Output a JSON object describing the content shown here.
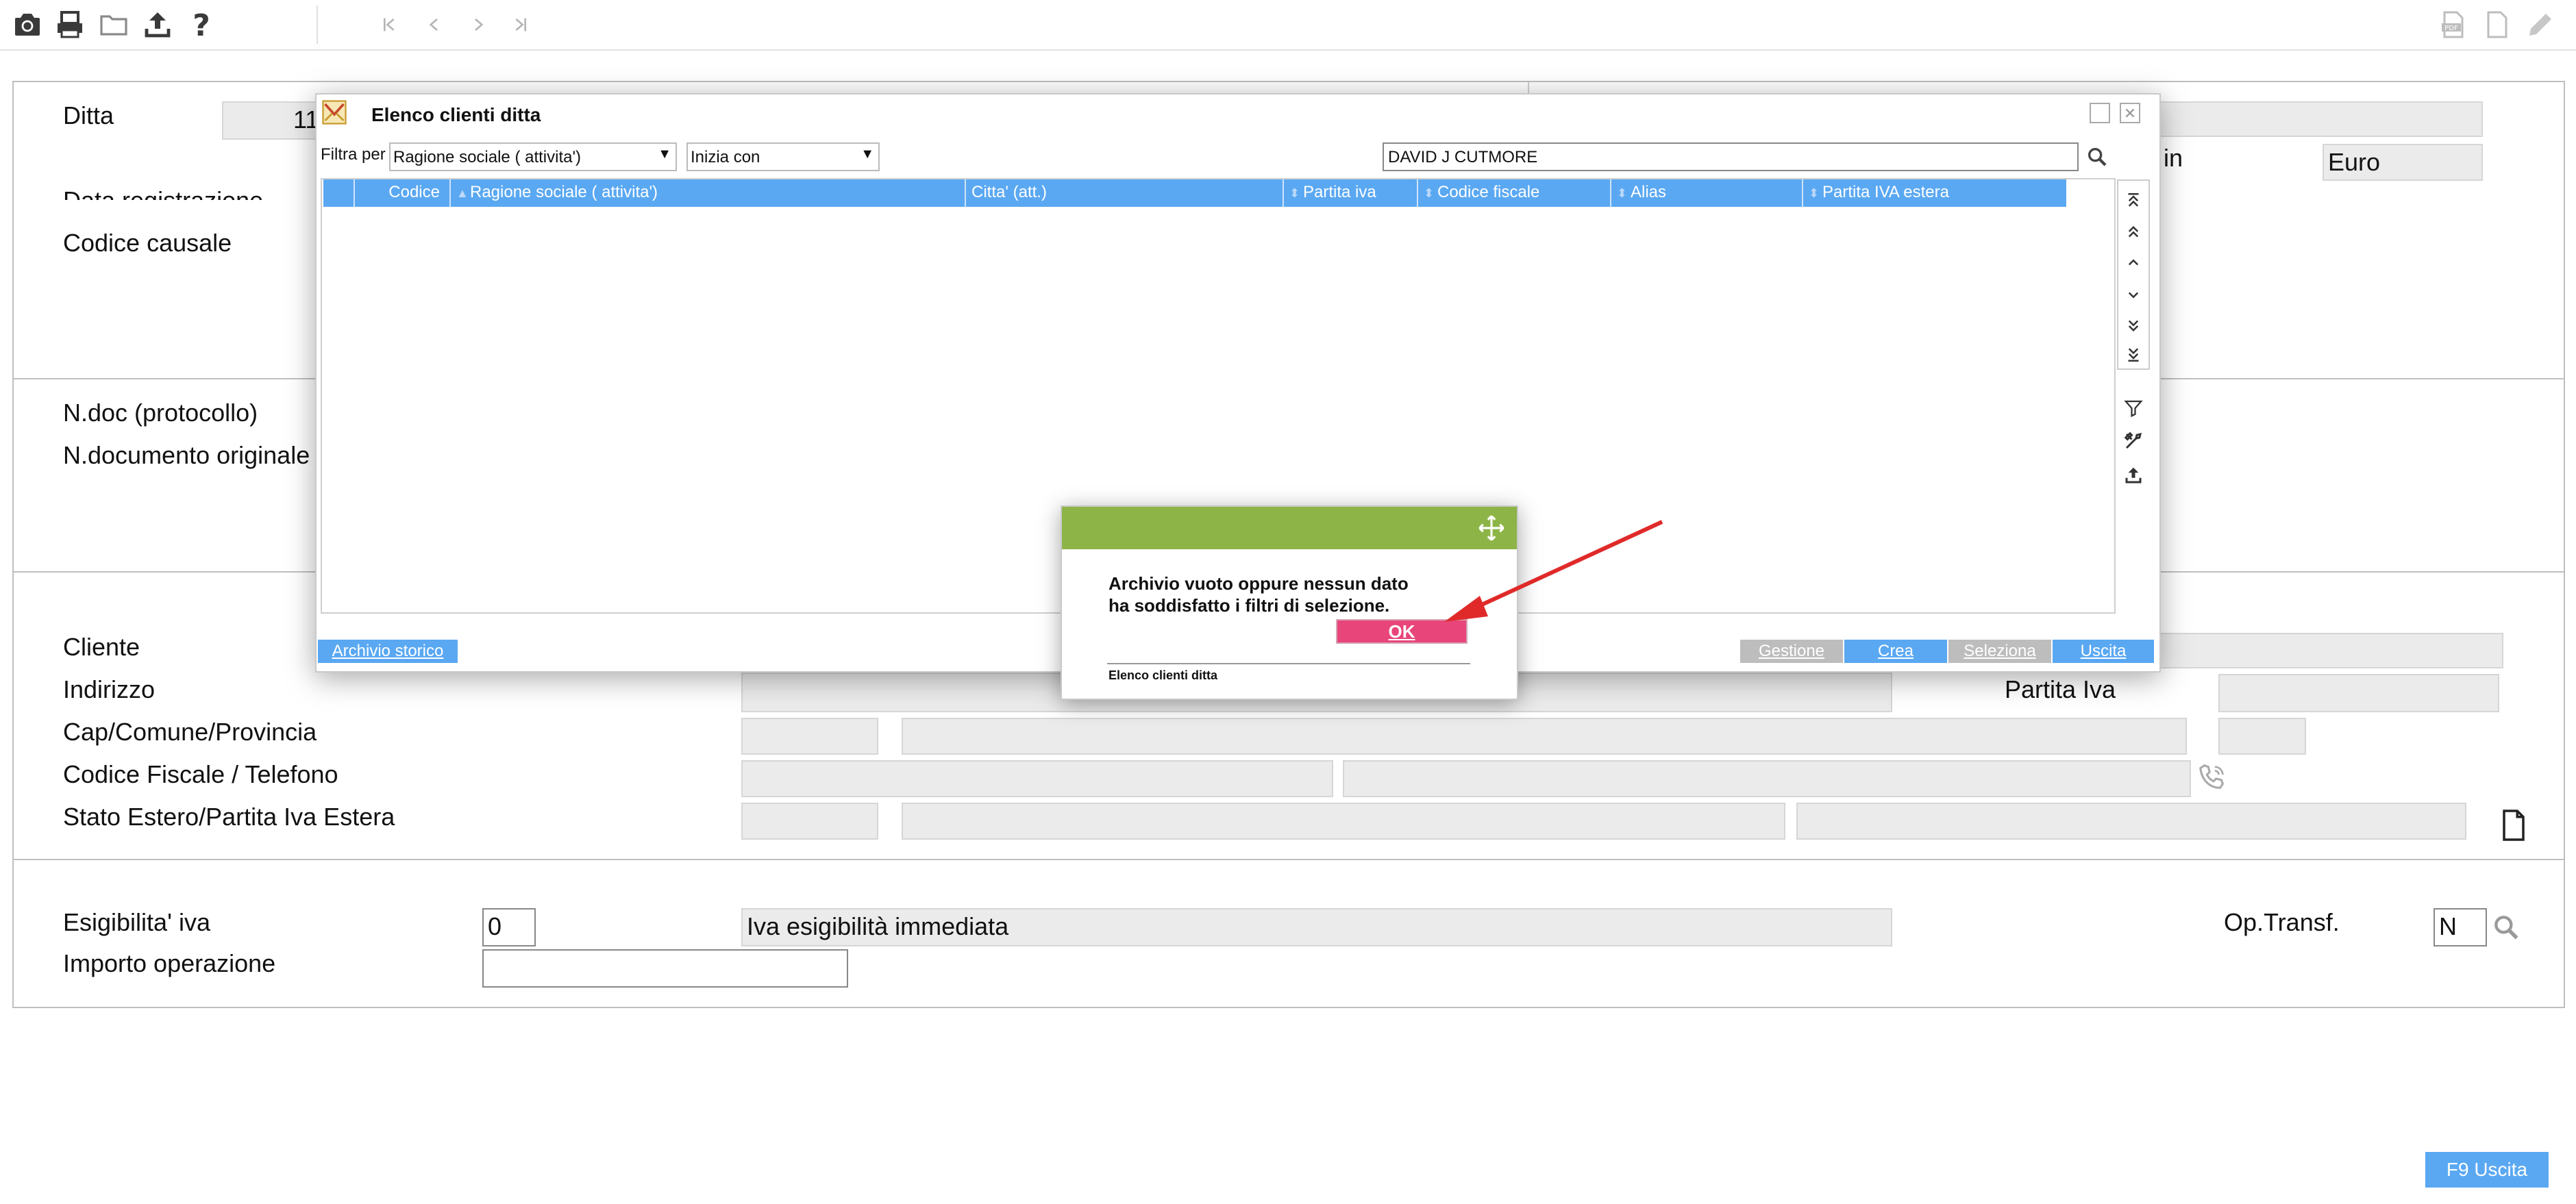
{
  "toolbar": {
    "icons": [
      "camera-icon",
      "printer-icon",
      "folder-icon",
      "upload-icon",
      "help-icon"
    ],
    "nav": [
      "first-page-icon",
      "prev-page-icon",
      "next-page-icon",
      "last-page-icon"
    ],
    "right_icons": [
      "pdf-icon",
      "document-icon",
      "edit-icon"
    ]
  },
  "form": {
    "ditta_label": "Ditta",
    "ditta_value": "11",
    "valuta_label_partial": "in",
    "valuta_value": "Euro",
    "data_registrazione_label": "Data registrazione",
    "codice_causale_label": "Codice causale",
    "ndoc_label": "N.doc (protocollo)",
    "ndoc_originale_label": "N.documento originale",
    "cliente_label": "Cliente",
    "indirizzo_label": "Indirizzo",
    "partita_iva_label": "Partita Iva",
    "cap_label": "Cap/Comune/Provincia",
    "cf_label": "Codice Fiscale / Telefono",
    "stato_estero_label": "Stato Estero/Partita Iva Estera",
    "esigibilita_label": "Esigibilita' iva",
    "esigibilita_code": "0",
    "esigibilita_desc": "Iva esigibilità immediata",
    "op_transf_label": "Op.Transf.",
    "op_transf_value": "N",
    "importo_label": "Importo operazione",
    "f9_button": "F9 Uscita"
  },
  "dialog": {
    "title": "Elenco clienti ditta",
    "filter_label": "Filtra per",
    "filter_field": "Ragione sociale ( attivita')",
    "filter_mode": "Inizia con",
    "search_value": "DAVID J CUTMORE",
    "columns": [
      "Codice",
      "Ragione sociale ( attivita')",
      "Citta' (att.)",
      "Partita iva",
      "Codice fiscale",
      "Alias",
      "Partita IVA estera"
    ],
    "buttons": {
      "archivio": "Archivio storico",
      "gestione": "Gestione",
      "crea": "Crea",
      "seleziona": "Seleziona",
      "uscita": "Uscita"
    }
  },
  "alert": {
    "message_line1": "Archivio vuoto oppure nessun dato",
    "message_line2": "ha soddisfatto i filtri di selezione.",
    "ok": "OK",
    "footer": "Elenco clienti ditta",
    "header_color": "#8db446"
  },
  "colors": {
    "accent_blue": "#5aa8f2",
    "button_disabled": "#bdbdbd",
    "ok_pink": "#e8457a",
    "arrow_red": "#e02a2a"
  }
}
